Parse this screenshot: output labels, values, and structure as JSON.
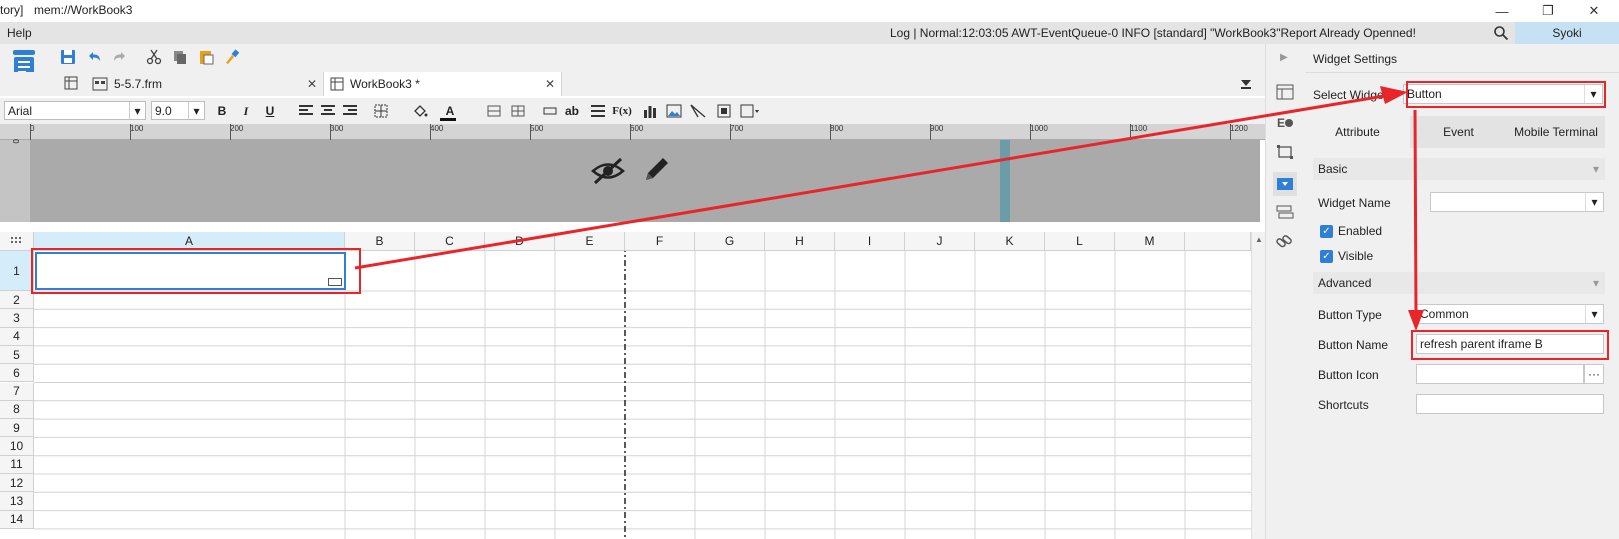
{
  "window": {
    "title_prefix": "tory]",
    "title": "mem://WorkBook3",
    "minimize_label": "—",
    "restore_label": "❐",
    "close_label": "✕"
  },
  "menu": {
    "help": "Help",
    "log": "Log | Normal:12:03:05 AWT-EventQueue-0 INFO [standard] \"WorkBook3\"Report Already Openned!",
    "user": "Syoki"
  },
  "tabs": [
    {
      "label": "5-5.7.frm",
      "close": "✕"
    },
    {
      "label": "WorkBook3 *",
      "close": "✕"
    }
  ],
  "format": {
    "font": "Arial",
    "size": "9.0",
    "bold": "B",
    "italic": "I",
    "underline": "U",
    "text_color_icon": "A",
    "ab_icon": "ab",
    "fx_icon": "F(x)"
  },
  "ruler": {
    "ticks": [
      "0",
      "100",
      "200",
      "300",
      "400",
      "500",
      "600",
      "700",
      "800",
      "900",
      "1000",
      "1100",
      "1200"
    ],
    "side": "0"
  },
  "sheet": {
    "columns": [
      "A",
      "B",
      "C",
      "D",
      "E",
      "F",
      "G",
      "H",
      "I",
      "J",
      "K",
      "L",
      "M"
    ],
    "rows": [
      "1",
      "2",
      "3",
      "4",
      "5",
      "6",
      "7",
      "8",
      "9",
      "10",
      "11",
      "12",
      "13",
      "14"
    ]
  },
  "panel": {
    "title": "Widget Settings",
    "select_widget_label": "Select Widget",
    "select_widget_value": "Button",
    "tab_attribute": "Attribute",
    "tab_event": "Event",
    "tab_mobile": "Mobile Terminal",
    "section_basic": "Basic",
    "widget_name_label": "Widget Name",
    "widget_name_value": "",
    "enabled_label": "Enabled",
    "visible_label": "Visible",
    "section_advanced": "Advanced",
    "button_type_label": "Button Type",
    "button_type_value": "Common",
    "button_name_label": "Button Name",
    "button_name_value": "refresh parent iframe B",
    "button_icon_label": "Button Icon",
    "button_icon_more": "···",
    "shortcuts_label": "Shortcuts",
    "collapse_icon": "▾"
  },
  "colors": {
    "accent": "#2f7fd6",
    "annotation": "#e8262a",
    "selected_col": "#d5ecfb",
    "design_bg": "#aaaaaa"
  }
}
